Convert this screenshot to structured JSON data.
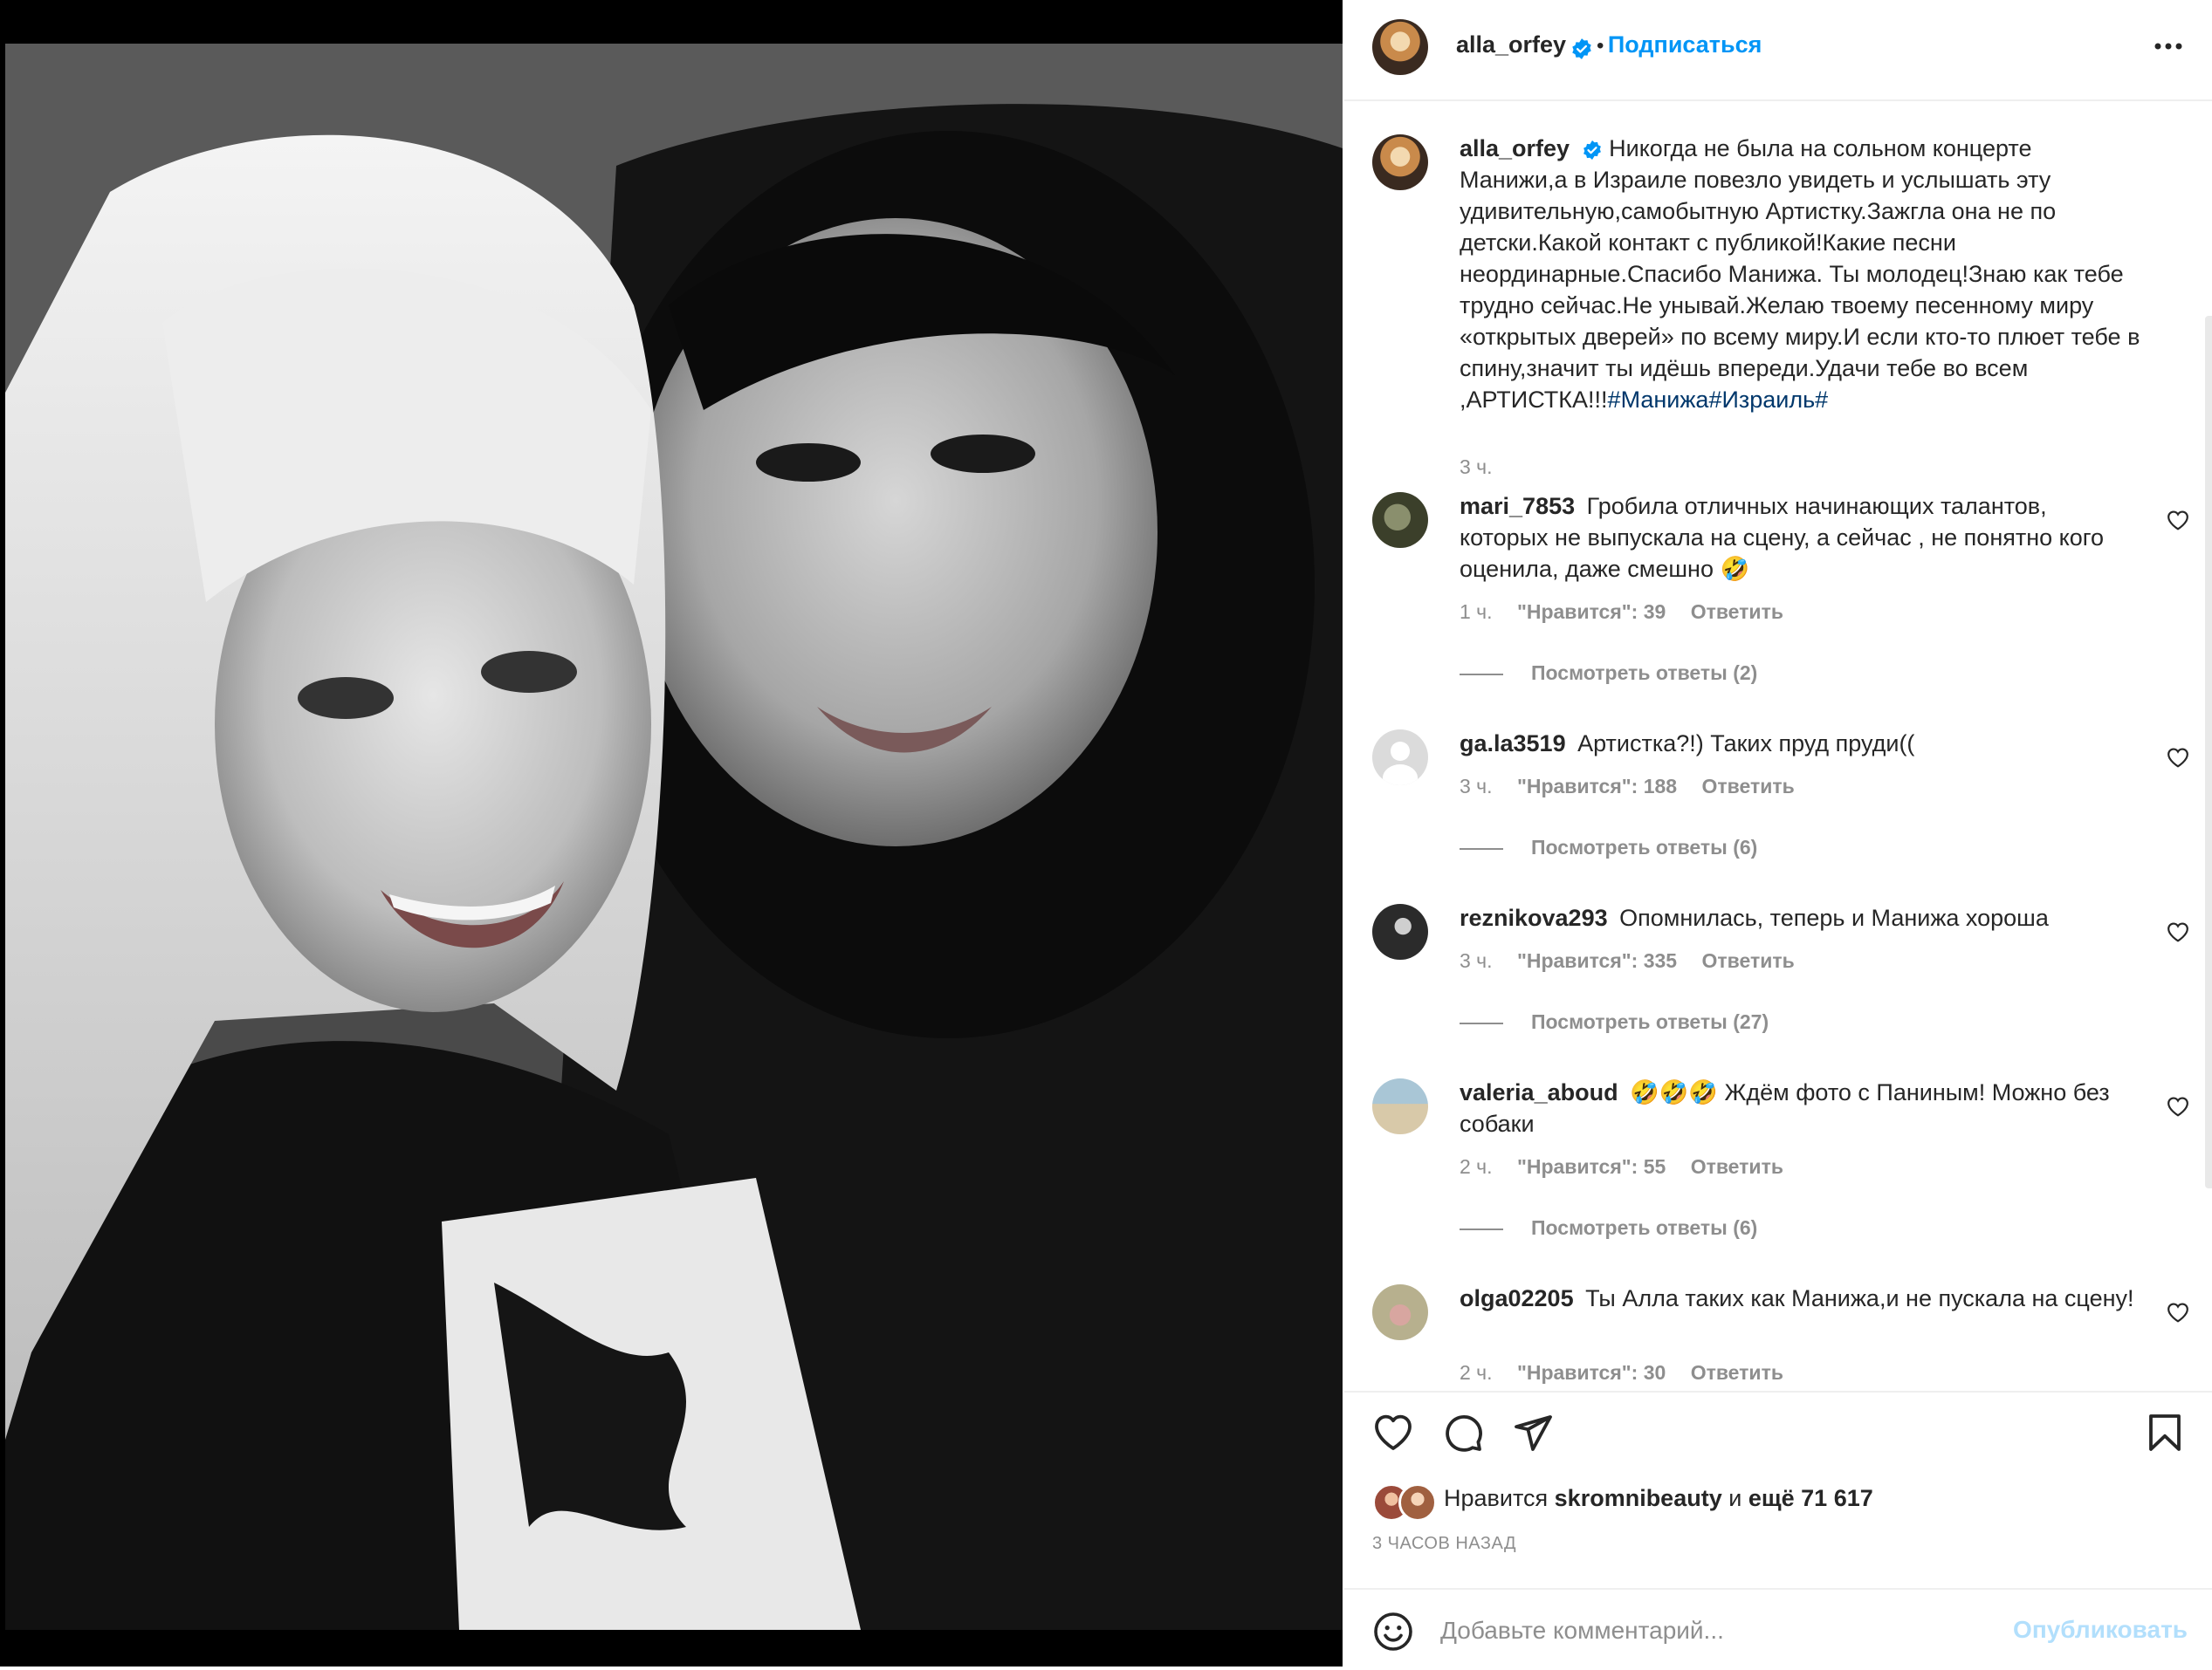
{
  "post": {
    "author": "alla_orfey",
    "follow_label": "Подписаться",
    "separator": "•",
    "caption": {
      "text": "Никогда не была на сольном концерте Манижи,а в Израиле повезло увидеть и услышать эту удивительную,самобытную Артистку.Зажгла она не по детски.Какой контакт с публикой!Какие песни неординарные.Спасибо Манижа. Ты молодец!Знаю как тебе трудно сейчас.Не унывай.Желаю твоему песенному миру «открытых дверей» по всему миру.И если кто-то плюет тебе в спину,значит ты идёшь впереди.Удачи тебе во всем ,АРТИСТКА!!!",
      "hashtags": "#Манижа#Израиль#",
      "time": "3 ч."
    }
  },
  "comments": [
    {
      "username": "mari_7853",
      "text": "Гробила отличных начинающих талантов, которых не выпускала на сцену, а сейчас , не понятно кого оценила, даже смешно 🤣",
      "time": "1 ч.",
      "likes": "\"Нравится\": 39",
      "reply": "Ответить",
      "view_replies": "Посмотреть ответы (2)"
    },
    {
      "username": "ga.la3519",
      "text": "Артистка?!) Таких пруд пруди((",
      "time": "3 ч.",
      "likes": "\"Нравится\": 188",
      "reply": "Ответить",
      "view_replies": "Посмотреть ответы (6)"
    },
    {
      "username": "reznikova293",
      "text": "Опомнилась, теперь и Манижа хороша",
      "time": "3 ч.",
      "likes": "\"Нравится\": 335",
      "reply": "Ответить",
      "view_replies": "Посмотреть ответы (27)"
    },
    {
      "username": "valeria_aboud",
      "text": "🤣🤣🤣 Ждём фото с Паниным! Можно без собаки",
      "time": "2 ч.",
      "likes": "\"Нравится\": 55",
      "reply": "Ответить",
      "view_replies": "Посмотреть ответы (6)"
    },
    {
      "username": "olga02205",
      "text": "Ты Алла таких как Манижа,и не пускала на сцену!",
      "time": "2 ч.",
      "likes": "\"Нравится\": 30",
      "reply": "Ответить"
    }
  ],
  "likes": {
    "prefix": "Нравится",
    "user": "skromnibeauty",
    "middle": "и",
    "rest": "ещё 71 617"
  },
  "timestamp": "3 ЧАСОВ НАЗАД",
  "comment_box": {
    "placeholder": "Добавьте комментарий...",
    "publish_label": "Опубликовать"
  },
  "colors": {
    "link_blue": "#0095f6",
    "hashtag_blue": "#00376b",
    "secondary_text": "#8e8e8e",
    "publish_disabled": "#b2dffc"
  }
}
